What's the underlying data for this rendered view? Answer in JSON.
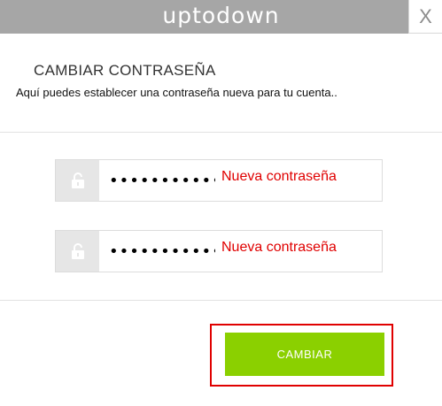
{
  "brand": {
    "logo_text": "uptodown"
  },
  "window": {
    "close_label": "X"
  },
  "header": {
    "title": "CAMBIAR CONTRASEÑA",
    "subtitle": "Aquí puedes establecer una contraseña nueva para tu cuenta.."
  },
  "form": {
    "password": {
      "value": "•••••••••••",
      "hint": "Nueva contraseña",
      "icon": "unlocked-padlock-icon"
    },
    "confirm_password": {
      "value": "•••••••••••",
      "hint": "Nueva contraseña",
      "icon": "unlocked-padlock-icon"
    },
    "submit_label": "CAMBIAR"
  },
  "colors": {
    "topbar": "#a6a6a6",
    "accent_button": "#8bd000",
    "hint_text": "#e00000",
    "highlight_border": "#e00000",
    "icon_box": "#e6e6e6"
  }
}
